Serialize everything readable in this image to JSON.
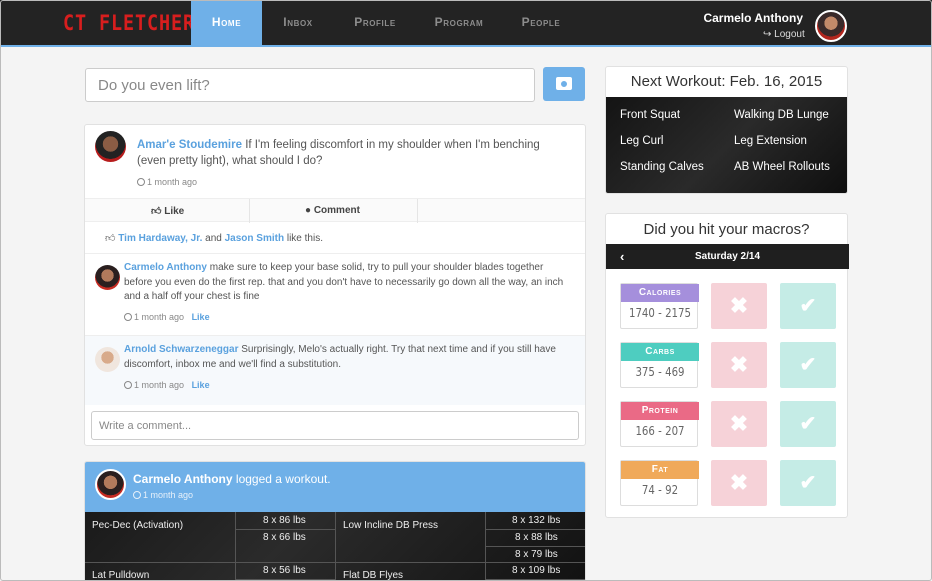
{
  "nav": {
    "logo": "CT FLETCHER",
    "tabs": [
      "Home",
      "Inbox",
      "Profile",
      "Program",
      "People"
    ],
    "user_name": "Carmelo Anthony",
    "logout": "Logout",
    "accent": "#6fb0e8"
  },
  "composer": {
    "placeholder": "Do you even lift?"
  },
  "post": {
    "author": "Amar'e Stoudemire",
    "text": "If I'm feeling discomfort in my shoulder when I'm benching (even pretty light), what should I do?",
    "time": "1 month ago",
    "like_label": "Like",
    "comment_label": "Comment",
    "likers": [
      "Tim Hardaway, Jr.",
      "Jason Smith"
    ],
    "likes_and": "and",
    "likes_suffix": "like this.",
    "comments": [
      {
        "author": "Carmelo Anthony",
        "text": "make sure to keep your base solid, try to pull your shoulder blades together before you even do the first rep. that and you don't have to necessarily go down all the way, an inch and a half off your chest is fine",
        "time": "1 month ago",
        "like": "Like"
      },
      {
        "author": "Arnold Schwarzeneggar",
        "text": "Surprisingly, Melo's actually right. Try that next time and if you still have discomfort, inbox me and we'll find a substitution.",
        "time": "1 month ago",
        "like": "Like"
      }
    ],
    "write_placeholder": "Write a comment..."
  },
  "workout_post": {
    "author": "Carmelo Anthony",
    "action": "logged a workout.",
    "time": "1 month ago",
    "rows": [
      {
        "exercise": "Pec-Dec (Activation)",
        "sets": [
          "8 x 86 lbs",
          "8 x 66 lbs"
        ]
      },
      {
        "exercise": "Low Incline DB Press",
        "sets": [
          "8 x 132 lbs",
          "8 x 88 lbs",
          "8 x 79 lbs"
        ]
      },
      {
        "exercise": "Lat Pulldown",
        "sets": [
          "8 x 56 lbs"
        ]
      },
      {
        "exercise": "Flat DB Flyes",
        "sets": [
          "8 x 109 lbs"
        ]
      }
    ]
  },
  "next_workout": {
    "title": "Next Workout: Feb. 16, 2015",
    "exercises": [
      "Front Squat",
      "Walking DB Lunge",
      "Leg Curl",
      "Leg Extension",
      "Standing Calves",
      "AB Wheel Rollouts"
    ]
  },
  "macros": {
    "title": "Did you hit your macros?",
    "day": "Saturday 2/14",
    "items": [
      {
        "name": "Calories",
        "range": "1740 - 2175",
        "color": "#a58fdc"
      },
      {
        "name": "Carbs",
        "range": "375 - 469",
        "color": "#4ecdc0"
      },
      {
        "name": "Protein",
        "range": "166 - 207",
        "color": "#ea6a86"
      },
      {
        "name": "Fat",
        "range": "74 - 92",
        "color": "#f0a95a"
      }
    ]
  }
}
